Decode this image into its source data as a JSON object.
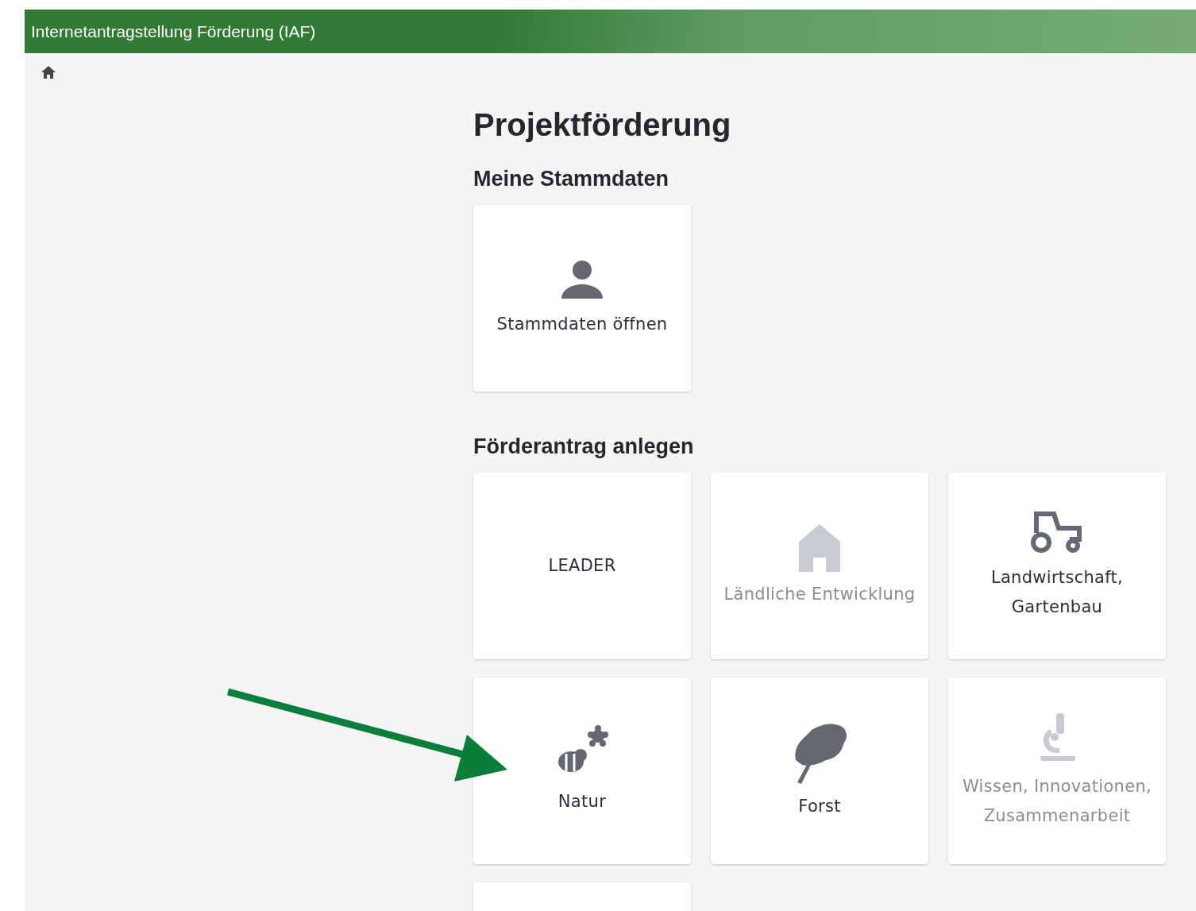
{
  "header": {
    "title": "Internetantragstellung Förderung (IAF)"
  },
  "page": {
    "title": "Projektförderung"
  },
  "sections": [
    {
      "title": "Meine Stammdaten",
      "tiles": [
        {
          "kind": "person",
          "label": "Stammdaten öffnen",
          "disabled": false
        }
      ]
    },
    {
      "title": "Förderantrag anlegen",
      "tiles": [
        {
          "kind": "text",
          "label": "LEADER",
          "disabled": false
        },
        {
          "kind": "house",
          "label": "Ländliche Entwicklung",
          "disabled": true
        },
        {
          "kind": "tractor",
          "label": "Landwirtschaft, Gartenbau",
          "disabled": false
        },
        {
          "kind": "bee",
          "label": "Natur",
          "disabled": false
        },
        {
          "kind": "leaf",
          "label": "Forst",
          "disabled": false
        },
        {
          "kind": "microscope",
          "label": "Wissen, Innovationen, Zusammenarbeit",
          "disabled": true
        },
        {
          "kind": "blank"
        }
      ]
    }
  ]
}
